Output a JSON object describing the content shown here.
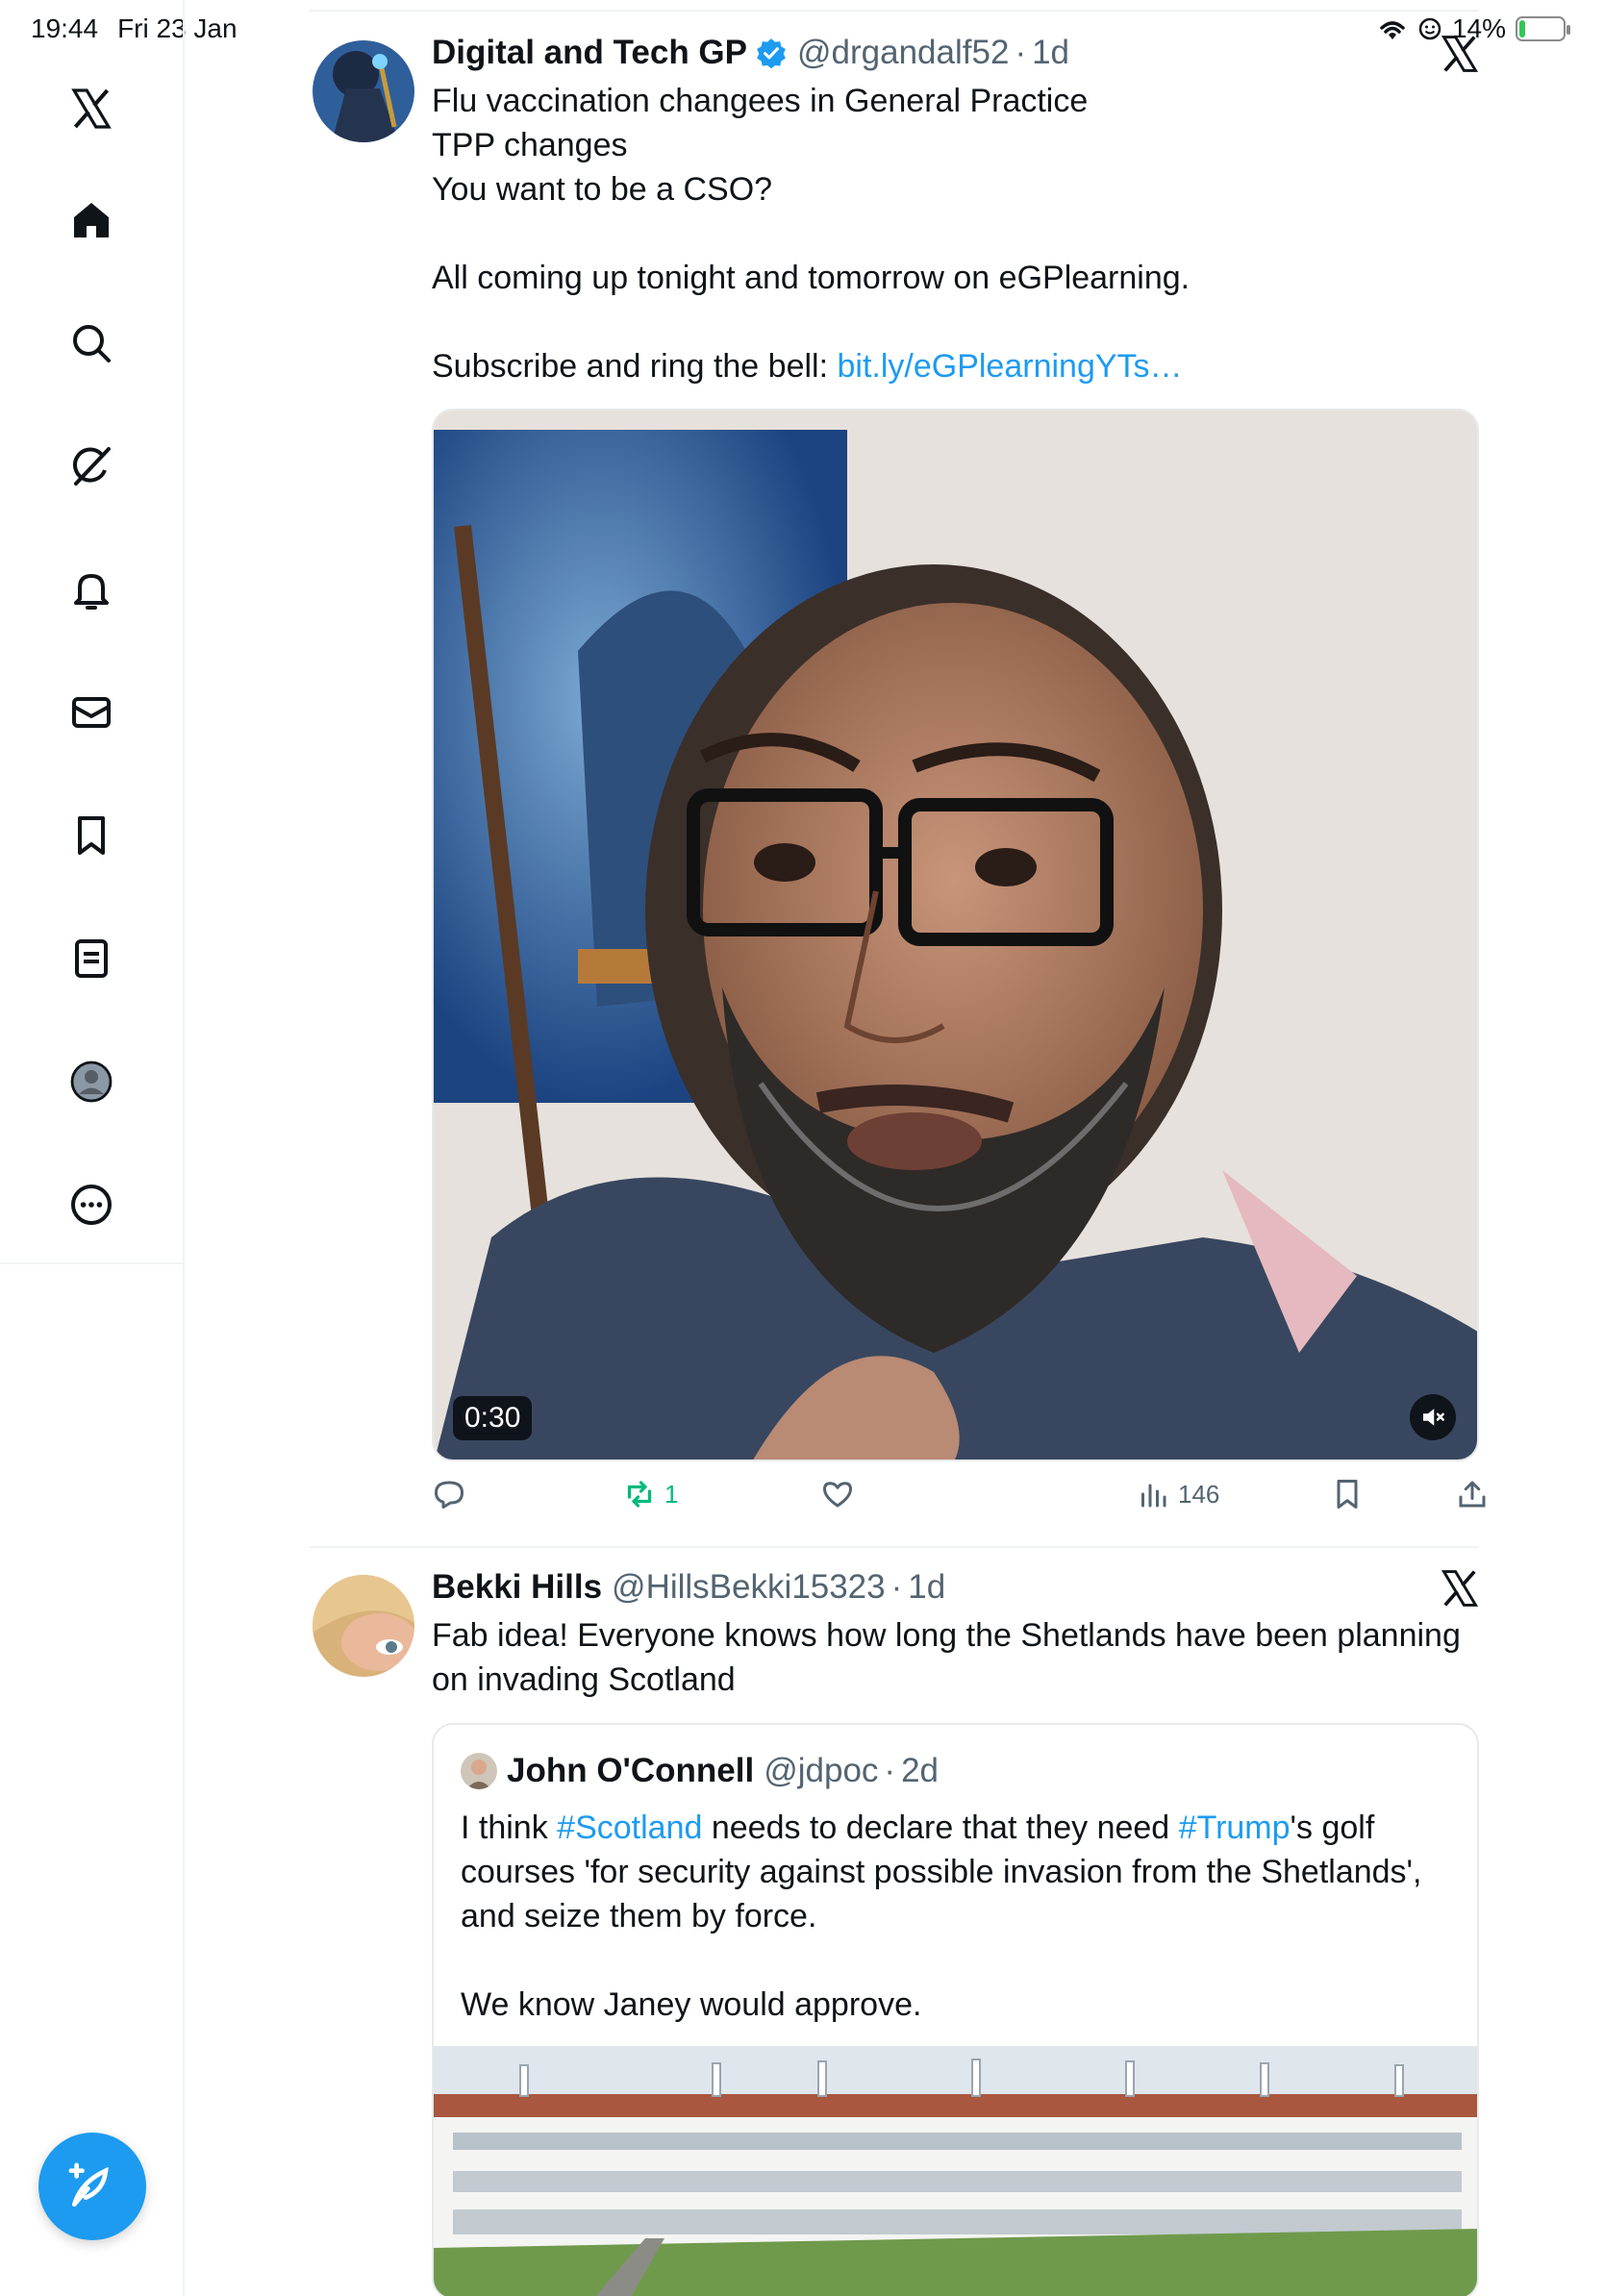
{
  "status_bar": {
    "time": "19:44",
    "date": "Fri 23 Jan",
    "battery": "14%",
    "battery_level": 0.14
  },
  "sidebar": {
    "items": [
      {
        "icon": "x-logo-icon"
      },
      {
        "icon": "home-icon"
      },
      {
        "icon": "search-icon"
      },
      {
        "icon": "grok-icon"
      },
      {
        "icon": "bell-icon"
      },
      {
        "icon": "mail-icon"
      },
      {
        "icon": "bookmark-icon"
      },
      {
        "icon": "lists-icon"
      },
      {
        "icon": "profile-icon"
      },
      {
        "icon": "more-icon"
      }
    ],
    "fab_icon": "compose-icon"
  },
  "post1": {
    "name": "Digital and Tech GP",
    "handle": "@drgandalf52",
    "separator": "·",
    "time": "1d",
    "text_main": "Flu vaccination changees in General Practice\nTPP changes\nYou want to be a CSO?\n\nAll coming up tonight and tomorrow on eGPlearning.\n\nSubscribe and ring the bell: ",
    "link": "bit.ly/eGPlearningYTs…",
    "video_duration": "0:30",
    "actions": {
      "reply": "",
      "repost": "1",
      "like": "",
      "views": "146"
    },
    "colors": {
      "repost": "#00ba7c",
      "link": "#1d9bf0"
    }
  },
  "post2": {
    "name": "Bekki Hills",
    "handle": "@HillsBekki15323",
    "separator": "·",
    "time": "1d",
    "text": "Fab idea! Everyone knows how long the Shetlands have been planning on invading Scotland",
    "quote": {
      "name": "John O'Connell",
      "handle": "@jdpoc",
      "separator": "·",
      "time": "2d",
      "text_1": "I think ",
      "hashtag_1": "#Scotland",
      "text_2": " needs to declare that they need ",
      "hashtag_2": "#Trump",
      "text_3": "'s golf courses 'for security against possible invasion from the Shetlands', and seize them by force.\n\nWe know Janey would approve."
    }
  }
}
